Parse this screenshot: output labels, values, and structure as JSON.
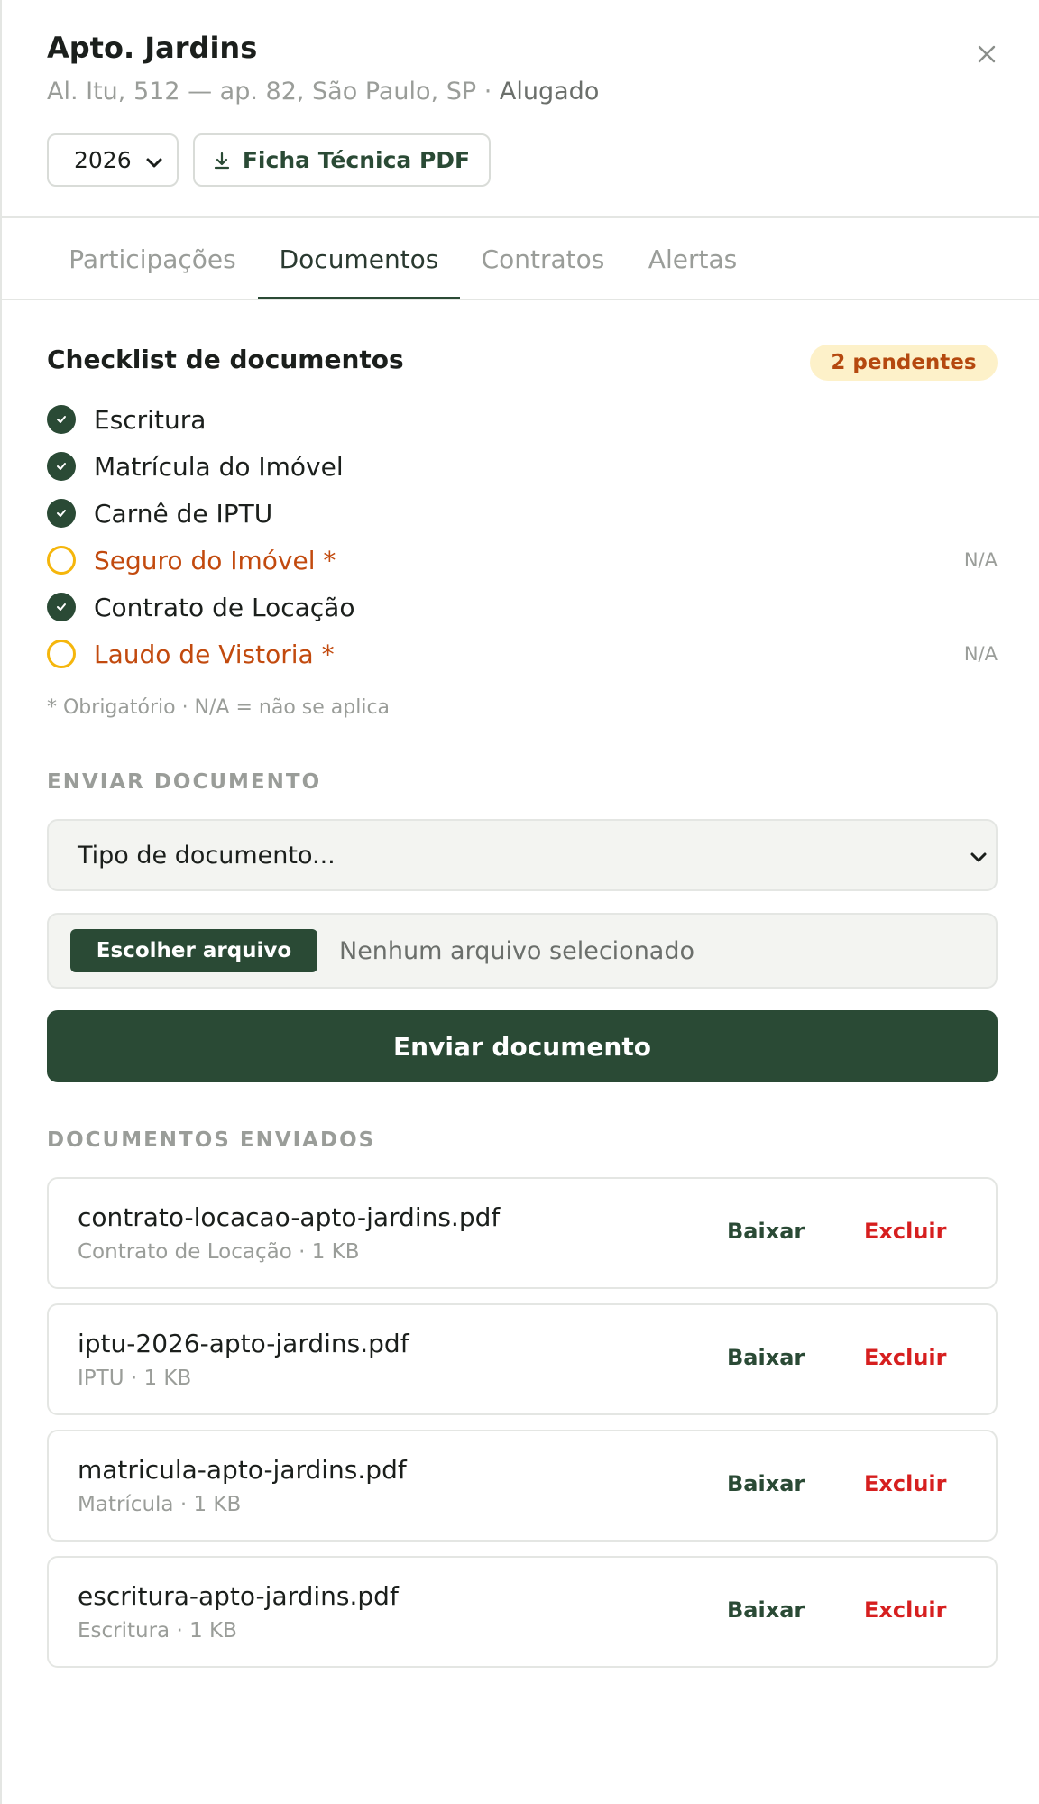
{
  "header": {
    "title": "Apto. Jardins",
    "address": "Al. Itu, 512 — ap. 82, São Paulo, SP",
    "separator": " · ",
    "status": "Alugado",
    "year": "2026",
    "pdf_label": "Ficha Técnica PDF"
  },
  "tabs": [
    {
      "label": "Participações",
      "active": false
    },
    {
      "label": "Documentos",
      "active": true
    },
    {
      "label": "Contratos",
      "active": false
    },
    {
      "label": "Alertas",
      "active": false
    }
  ],
  "checklist": {
    "title": "Checklist de documentos",
    "badge": "2 pendentes",
    "items": [
      {
        "label": "Escritura",
        "done": true
      },
      {
        "label": "Matrícula do Imóvel",
        "done": true
      },
      {
        "label": "Carnê de IPTU",
        "done": true
      },
      {
        "label": "Seguro do Imóvel *",
        "done": false,
        "note": "N/A"
      },
      {
        "label": "Contrato de Locação",
        "done": true
      },
      {
        "label": "Laudo de Vistoria *",
        "done": false,
        "note": "N/A"
      }
    ],
    "footnote": "* Obrigatório · N/A = não se aplica"
  },
  "upload": {
    "section_label": "ENVIAR DOCUMENTO",
    "type_placeholder": "Tipo de documento...",
    "choose_file": "Escolher arquivo",
    "no_file": "Nenhum arquivo selecionado",
    "submit": "Enviar documento"
  },
  "sent": {
    "section_label": "DOCUMENTOS ENVIADOS",
    "download_label": "Baixar",
    "delete_label": "Excluir",
    "items": [
      {
        "name": "contrato-locacao-apto-jardins.pdf",
        "meta": "Contrato de Locação · 1 KB"
      },
      {
        "name": "iptu-2026-apto-jardins.pdf",
        "meta": "IPTU · 1 KB"
      },
      {
        "name": "matricula-apto-jardins.pdf",
        "meta": "Matrícula · 1 KB"
      },
      {
        "name": "escritura-apto-jardins.pdf",
        "meta": "Escritura · 1 KB"
      }
    ]
  },
  "colors": {
    "brand": "#2a4a35",
    "pending": "#c24a0e",
    "pending_ring": "#f5b60c",
    "danger": "#d61f1f",
    "badge_bg": "#fdf1c9"
  }
}
